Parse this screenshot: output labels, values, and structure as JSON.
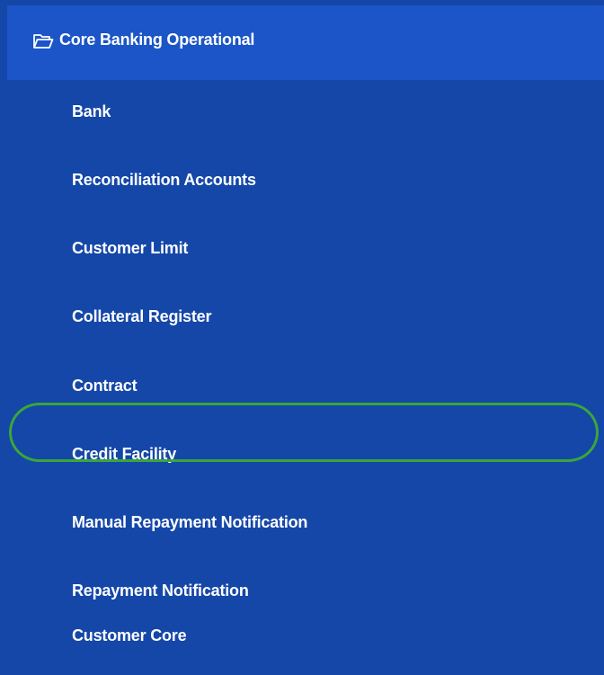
{
  "sidebar": {
    "group_title": "Core Banking Operational",
    "group_icon": "folder-open-icon",
    "items": [
      {
        "label": "Bank"
      },
      {
        "label": "Reconciliation Accounts"
      },
      {
        "label": "Customer Limit"
      },
      {
        "label": "Collateral Register"
      },
      {
        "label": "Contract"
      },
      {
        "label": "Credit Facility",
        "highlighted": true
      },
      {
        "label": "Manual Repayment Notification"
      },
      {
        "label": "Repayment Notification"
      },
      {
        "label": "Customer Core"
      }
    ]
  },
  "colors": {
    "sidebar_background": "#1447a8",
    "header_background": "#1b55c7",
    "text": "#ffffff",
    "highlight_annotation": "#3aa63a"
  }
}
